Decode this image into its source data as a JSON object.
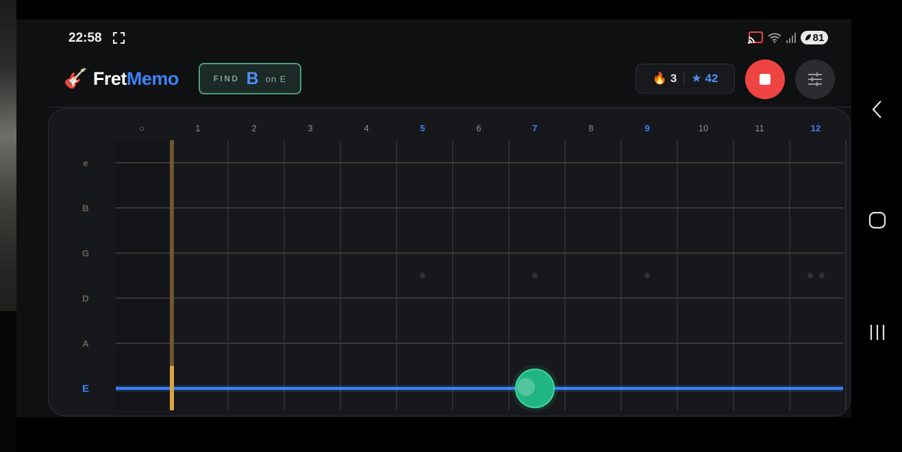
{
  "status_bar": {
    "time": "22:58",
    "battery": "81",
    "icons": [
      "fullscreen-icon",
      "cast-icon",
      "wifi-icon",
      "signal-icon",
      "battery-icon"
    ]
  },
  "header": {
    "logo_emoji": "🎸",
    "logo_part1": "Fret",
    "logo_part2": "Memo",
    "find_label": "FIND",
    "find_note": "B",
    "find_string": "on E",
    "streak_emoji": "🔥",
    "streak": "3",
    "star_symbol": "★",
    "stars": "42"
  },
  "colors": {
    "accent_blue": "#3b82f6",
    "stop_red": "#ef4444",
    "target_green": "#22b584",
    "nut_gold": "#d9a441"
  },
  "fretboard": {
    "fret_numbers": [
      "○",
      "1",
      "2",
      "3",
      "4",
      "5",
      "6",
      "7",
      "8",
      "9",
      "10",
      "11",
      "12"
    ],
    "highlighted_frets": [
      "5",
      "7",
      "9",
      "12"
    ],
    "strings": [
      "e",
      "B",
      "G",
      "D",
      "A",
      "E"
    ],
    "active_string": "E",
    "marker_frets": [
      5,
      7,
      9,
      12
    ],
    "target": {
      "string": "E",
      "fret": 7
    }
  }
}
